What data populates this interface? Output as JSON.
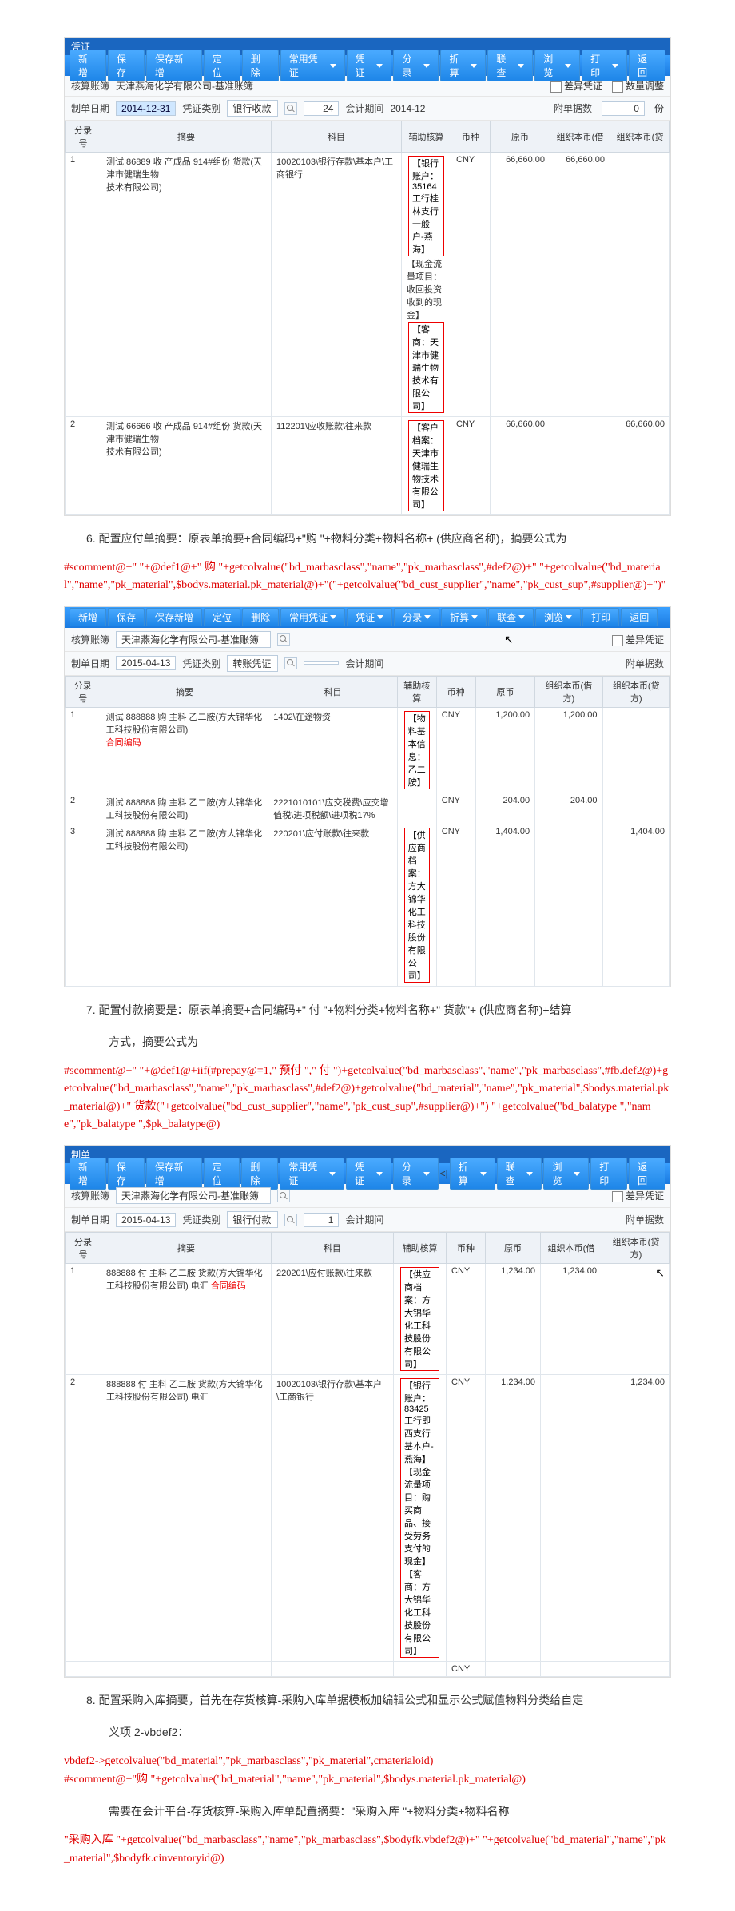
{
  "toolbar": {
    "buttons": [
      "新增",
      "保存",
      "保存新增",
      "定位",
      "删除",
      "常用凭证",
      "凭证",
      "分录",
      "折算",
      "联查",
      "浏览",
      "打印",
      "返回"
    ],
    "dropdowns": {
      "5": true,
      "6": true,
      "7": true,
      "8": true,
      "9": true,
      "10": true,
      "11": true
    }
  },
  "labels": {
    "ledger": "核算账簿",
    "date": "制单日期",
    "voucherType": "凭证类别",
    "period": "会计期间",
    "diffVoucher": "差异凭证",
    "numAdjust": "数量调整",
    "attachCount": "附单据数",
    "zero": "0"
  },
  "panel1": {
    "titlebar": "凭证",
    "ledger": "天津燕海化学有限公司-基准账簿",
    "date": "2014-12-31",
    "voucherType": "银行收款",
    "voucherNo": "24",
    "period": "2014-12",
    "headers": [
      "分录号",
      "摘要",
      "科目",
      "辅助核算",
      "币种",
      "原币",
      "组织本币(借",
      "组织本币(贷"
    ],
    "rows": [
      {
        "idx": "1",
        "summary_a": "测试 86889 收 产成品 914#组份 货款(天津市健瑞生物",
        "summary_b": "技术有限公司)",
        "subject": "10020103\\银行存款\\基本户\\工商银行",
        "aux": [
          "【银行账户：35164工行桂林支行一般户-燕海】",
          "【现金流量项目：",
          "收回投资收到的现金】",
          "【客商：天津市健瑞生物技术有限公司】"
        ],
        "currency": "CNY",
        "orig": "66,660.00",
        "debit": "66,660.00",
        "credit": ""
      },
      {
        "idx": "2",
        "summary_a": "测试 66666 收 产成品 914#组份 货款(天津市健瑞生物",
        "summary_b": "技术有限公司)",
        "subject": "112201\\应收账款\\往来款",
        "aux": [
          "【客户档案：天津市健瑞生物技术有限公司】"
        ],
        "currency": "CNY",
        "orig": "66,660.00",
        "debit": "",
        "credit": "66,660.00"
      }
    ]
  },
  "section6": {
    "text": "6. 配置应付单摘要：原表单摘要+合同编码+\"购  \"+物料分类+物料名称+ (供应商名称)，摘要公式为",
    "formula": "#scomment@+\" \"+@def1@+\" 购 \"+getcolvalue(\"bd_marbasclass\",\"name\",\"pk_marbasclass\",#def2@)+\" \"+getcolvalue(\"bd_material\",\"name\",\"pk_material\",$bodys.material.pk_material@)+\"(\"+getcolvalue(\"bd_cust_supplier\",\"name\",\"pk_cust_sup\",#supplier@)+\")\""
  },
  "panel2": {
    "ledger": "天津燕海化学有限公司-基准账簿",
    "date": "2015-04-13",
    "voucherType": "转账凭证",
    "headers": [
      "分录号",
      "摘要",
      "科目",
      "辅助核算",
      "币种",
      "原币",
      "组织本币(借方)",
      "组织本币(贷方)"
    ],
    "anno_contract": "合同编码",
    "rows": [
      {
        "idx": "1",
        "summary": "测试 888888 购 主料 乙二胺(方大锦华化工科技股份有限公司)",
        "subject": "1402\\在途物资",
        "aux": "【物料基本信息：乙二胺】",
        "currency": "CNY",
        "orig": "1,200.00",
        "debit": "1,200.00",
        "credit": ""
      },
      {
        "idx": "2",
        "summary": "测试 888888 购 主料 乙二胺(方大锦华化工科技股份有限公司)",
        "subject": "2221010101\\应交税费\\应交增值税\\进项税额\\进项税17%",
        "aux": "",
        "currency": "CNY",
        "orig": "204.00",
        "debit": "204.00",
        "credit": ""
      },
      {
        "idx": "3",
        "summary": "测试 888888 购 主料 乙二胺(方大锦华化工科技股份有限公司)",
        "subject": "220201\\应付账款\\往来款",
        "aux": "【供应商档案：方大锦华化工科技股份有限公司】",
        "currency": "CNY",
        "orig": "1,404.00",
        "debit": "",
        "credit": "1,404.00"
      }
    ]
  },
  "section7": {
    "text": "7. 配置付款摘要是：原表单摘要+合同编码+\" 付 \"+物料分类+物料名称+\" 货款\"+ (供应商名称)+结算",
    "text2": "方式，摘要公式为",
    "formula": "#scomment@+\" \"+@def1@+iif(#prepay@=1,\" 预付 \",\" 付 \")+getcolvalue(\"bd_marbasclass\",\"name\",\"pk_marbasclass\",#fb.def2@)+getcolvalue(\"bd_marbasclass\",\"name\",\"pk_marbasclass\",#def2@)+getcolvalue(\"bd_material\",\"name\",\"pk_material\",$bodys.material.pk_material@)+\" 货款(\"+getcolvalue(\"bd_cust_supplier\",\"name\",\"pk_cust_sup\",#supplier@)+\") \"+getcolvalue(\"bd_balatype \",\"name\",\"pk_balatype \",$pk_balatype@)"
  },
  "panel3": {
    "titlebar": "制单",
    "ledger": "天津燕海化学有限公司-基准账簿",
    "date": "2015-04-13",
    "voucherType": "银行付款",
    "voucherNo": "1",
    "headers": [
      "分录号",
      "摘要",
      "科目",
      "辅助核算",
      "币种",
      "原币",
      "组织本币(借",
      "组织本币(贷方)"
    ],
    "anno_contract": "合同编码",
    "rows": [
      {
        "idx": "1",
        "summary": "888888 付 主料 乙二胺 货款(方大锦华化工科技股份有限公司) 电汇",
        "subject": "220201\\应付账款\\往来款",
        "aux": "【供应商档案：方大锦华化工科技股份有限公司】",
        "currency": "CNY",
        "orig": "1,234.00",
        "debit": "1,234.00",
        "credit": ""
      },
      {
        "idx": "2",
        "summary": "888888 付 主料 乙二胺 货款(方大锦华化工科技股份有限公司) 电汇",
        "subject": "10020103\\银行存款\\基本户\\工商银行",
        "aux": "【银行账户：83425工行即西支行基本户-燕海】【现金流量项目：购买商品、接受劳务支付的现金】【客商：方大锦华化工科技股份有限公司】",
        "currency": "CNY",
        "orig": "1,234.00",
        "debit": "",
        "credit": "1,234.00"
      },
      {
        "idx": "",
        "summary": "",
        "subject": "",
        "aux": "",
        "currency": "CNY",
        "orig": "",
        "debit": "",
        "credit": ""
      }
    ]
  },
  "section8": {
    "text": "8. 配置采购入库摘要，首先在存货核算-采购入库单据模板加编辑公式和显示公式赋值物料分类给自定",
    "text2": "义项 2-vbdef2：",
    "formula1": "vbdef2->getcolvalue(\"bd_material\",\"pk_marbasclass\",\"pk_material\",cmaterialoid)\n#scomment@+\"购 \"+getcolvalue(\"bd_material\",\"name\",\"pk_material\",$bodys.material.pk_material@)",
    "text3": "需要在会计平台-存货核算-采购入库单配置摘要：\"采购入库 \"+物料分类+物料名称",
    "formula2": "\"采购入库 \"+getcolvalue(\"bd_marbasclass\",\"name\",\"pk_marbasclass\",$bodyfk.vbdef2@)+\" \"+getcolvalue(\"bd_material\",\"name\",\"pk_material\",$bodyfk.cinventoryid@)"
  }
}
